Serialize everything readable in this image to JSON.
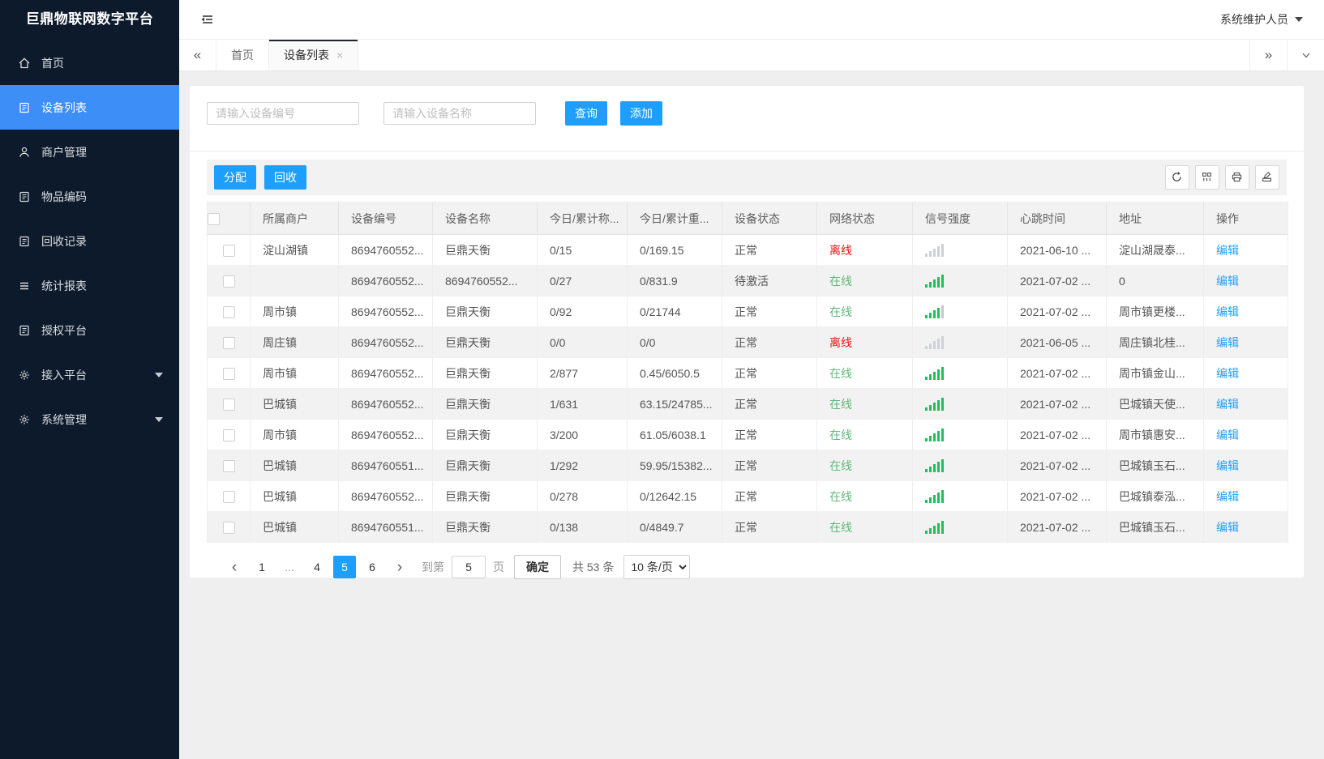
{
  "app": {
    "title": "巨鼎物联网数字平台",
    "user_role": "系统维护人员"
  },
  "sidebar": {
    "items": [
      {
        "label": "首页",
        "icon": "home-icon",
        "active": false,
        "expandable": false
      },
      {
        "label": "设备列表",
        "icon": "list-icon",
        "active": true,
        "expandable": false
      },
      {
        "label": "商户管理",
        "icon": "user-icon",
        "active": false,
        "expandable": false
      },
      {
        "label": "物品编码",
        "icon": "doc-icon",
        "active": false,
        "expandable": false
      },
      {
        "label": "回收记录",
        "icon": "doc-icon",
        "active": false,
        "expandable": false
      },
      {
        "label": "统计报表",
        "icon": "report-icon",
        "active": false,
        "expandable": false
      },
      {
        "label": "授权平台",
        "icon": "doc-icon",
        "active": false,
        "expandable": false
      },
      {
        "label": "接入平台",
        "icon": "gear-icon",
        "active": false,
        "expandable": true
      },
      {
        "label": "系统管理",
        "icon": "gear-icon",
        "active": false,
        "expandable": true
      }
    ]
  },
  "tabbar": {
    "collapse_glyph": "«",
    "expand_glyph": "»",
    "close_glyph": "×",
    "tabs": [
      {
        "label": "首页",
        "active": false,
        "closable": false
      },
      {
        "label": "设备列表",
        "active": true,
        "closable": true
      }
    ]
  },
  "search": {
    "device_no_placeholder": "请输入设备编号",
    "device_name_placeholder": "请输入设备名称",
    "query_label": "查询",
    "add_label": "添加"
  },
  "toolbar": {
    "assign_label": "分配",
    "recycle_label": "回收",
    "icons": [
      "refresh-icon",
      "columns-icon",
      "printer-icon",
      "export-icon"
    ]
  },
  "table": {
    "columns": [
      "所属商户",
      "设备编号",
      "设备名称",
      "今日/累计称...",
      "今日/累计重...",
      "设备状态",
      "网络状态",
      "信号强度",
      "心跳时间",
      "地址",
      "操作"
    ],
    "edit_label": "编辑",
    "rows": [
      {
        "merchant": "淀山湖镇",
        "device_no": "8694760552...",
        "device_name": "巨鼎天衡",
        "today_count": "0/15",
        "today_weight": "0/169.15",
        "device_status": "正常",
        "network_status": "离线",
        "network_state": "offline",
        "signal": "off",
        "heartbeat": "2021-06-10 ...",
        "address": "淀山湖晟泰..."
      },
      {
        "merchant": "",
        "device_no": "8694760552...",
        "device_name": "8694760552...",
        "today_count": "0/27",
        "today_weight": "0/831.9",
        "device_status": "待激活",
        "network_status": "在线",
        "network_state": "online",
        "signal": "full",
        "heartbeat": "2021-07-02 ...",
        "address": "0"
      },
      {
        "merchant": "周市镇",
        "device_no": "8694760552...",
        "device_name": "巨鼎天衡",
        "today_count": "0/92",
        "today_weight": "0/21744",
        "device_status": "正常",
        "network_status": "在线",
        "network_state": "online",
        "signal": "four",
        "heartbeat": "2021-07-02 ...",
        "address": "周市镇更楼..."
      },
      {
        "merchant": "周庄镇",
        "device_no": "8694760552...",
        "device_name": "巨鼎天衡",
        "today_count": "0/0",
        "today_weight": "0/0",
        "device_status": "正常",
        "network_status": "离线",
        "network_state": "offline",
        "signal": "off",
        "heartbeat": "2021-06-05 ...",
        "address": "周庄镇北桂..."
      },
      {
        "merchant": "周市镇",
        "device_no": "8694760552...",
        "device_name": "巨鼎天衡",
        "today_count": "2/877",
        "today_weight": "0.45/6050.5",
        "device_status": "正常",
        "network_status": "在线",
        "network_state": "online",
        "signal": "full",
        "heartbeat": "2021-07-02 ...",
        "address": "周市镇金山..."
      },
      {
        "merchant": "巴城镇",
        "device_no": "8694760552...",
        "device_name": "巨鼎天衡",
        "today_count": "1/631",
        "today_weight": "63.15/24785...",
        "device_status": "正常",
        "network_status": "在线",
        "network_state": "online",
        "signal": "full",
        "heartbeat": "2021-07-02 ...",
        "address": "巴城镇天使..."
      },
      {
        "merchant": "周市镇",
        "device_no": "8694760552...",
        "device_name": "巨鼎天衡",
        "today_count": "3/200",
        "today_weight": "61.05/6038.1",
        "device_status": "正常",
        "network_status": "在线",
        "network_state": "online",
        "signal": "full",
        "heartbeat": "2021-07-02 ...",
        "address": "周市镇惠安..."
      },
      {
        "merchant": "巴城镇",
        "device_no": "8694760551...",
        "device_name": "巨鼎天衡",
        "today_count": "1/292",
        "today_weight": "59.95/15382...",
        "device_status": "正常",
        "network_status": "在线",
        "network_state": "online",
        "signal": "full",
        "heartbeat": "2021-07-02 ...",
        "address": "巴城镇玉石..."
      },
      {
        "merchant": "巴城镇",
        "device_no": "8694760552...",
        "device_name": "巨鼎天衡",
        "today_count": "0/278",
        "today_weight": "0/12642.15",
        "device_status": "正常",
        "network_status": "在线",
        "network_state": "online",
        "signal": "full",
        "heartbeat": "2021-07-02 ...",
        "address": "巴城镇泰泓..."
      },
      {
        "merchant": "巴城镇",
        "device_no": "8694760551...",
        "device_name": "巨鼎天衡",
        "today_count": "0/138",
        "today_weight": "0/4849.7",
        "device_status": "正常",
        "network_status": "在线",
        "network_state": "online",
        "signal": "full",
        "heartbeat": "2021-07-02 ...",
        "address": "巴城镇玉石..."
      }
    ]
  },
  "pagination": {
    "prev_glyph": "‹",
    "next_glyph": "›",
    "pages": [
      "1",
      "...",
      "4",
      "5",
      "6"
    ],
    "active_page": "5",
    "jump_label": "到第",
    "jump_value": "5",
    "page_unit": "页",
    "confirm_label": "确定",
    "total_label": "共 53 条",
    "page_size": "10 条/页"
  },
  "colors": {
    "accent": "#1e9fff",
    "sidebar_bg": "#0c1a2c",
    "sidebar_active": "#3d8ef7",
    "online_green": "#5fb878",
    "offline_red": "#f50f0f",
    "signal_on": "#1fc05c",
    "signal_off": "#cdd2d9"
  }
}
